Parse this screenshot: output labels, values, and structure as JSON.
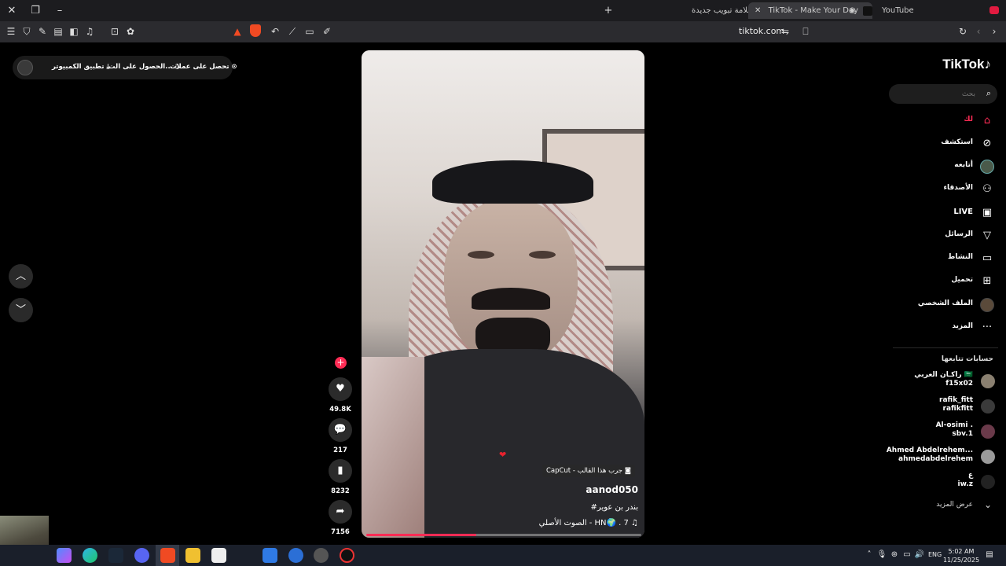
{
  "browser": {
    "tabs": [
      {
        "title": "علامة تبويب جديدة"
      },
      {
        "title": "TikTok - Make Your Day"
      },
      {
        "title": "YouTube"
      }
    ],
    "url": "tiktok.com"
  },
  "promo": {
    "items": [
      {
        "label": "تحصل على عملات",
        "icon": "coin-icon"
      },
      {
        "label": "الحصول على الت...",
        "icon": "phone-icon"
      },
      {
        "label": "تطبيق الكمبيوتر",
        "icon": "download-icon"
      }
    ]
  },
  "video": {
    "effect": "CapCut - جرب هذا القالب",
    "username": "aanod050",
    "hashtag": "#بندر بن عوير",
    "music": "الصوت الأصلي - HN🌍 . 7",
    "progress_percent": 40
  },
  "actions": {
    "likes": "49.8K",
    "comments": "217",
    "saves": "8232",
    "shares": "7156"
  },
  "sidebar": {
    "logo": "TikTok",
    "search_placeholder": "بحث",
    "nav": [
      {
        "label": "لك",
        "icon": "home-icon",
        "active": true
      },
      {
        "label": "استكشف",
        "icon": "compass-icon"
      },
      {
        "label": "أتابعه",
        "icon": "avatar-icon"
      },
      {
        "label": "الأصدقاء",
        "icon": "friends-icon"
      },
      {
        "label": "LIVE",
        "icon": "live-icon"
      },
      {
        "label": "الرسائل",
        "icon": "messages-icon"
      },
      {
        "label": "النشاط",
        "icon": "activity-icon"
      },
      {
        "label": "تحميل",
        "icon": "upload-icon"
      },
      {
        "label": "الملف الشخصي",
        "icon": "profile-icon"
      },
      {
        "label": "المزيد",
        "icon": "more-icon"
      }
    ],
    "following_title": "حسابات تتابعها",
    "following": [
      {
        "name": "راكـان العربي 🇸🇦",
        "handle": "f15x02"
      },
      {
        "name": "rafik_fitt",
        "handle": "rafikfitt"
      },
      {
        "name": "Al-osimi .",
        "handle": "sbv.1"
      },
      {
        "name": "Ahmed Abdelrehem...",
        "handle": "ahmedabdelrehem"
      },
      {
        "name": "ع",
        "handle": "iw.z"
      }
    ],
    "see_more": "عرض المزيد"
  },
  "taskbar": {
    "language": "ENG",
    "time": "5:02 AM",
    "date": "11/25/2025"
  },
  "colors": {
    "accent": "#fe2c55",
    "background": "#000000",
    "sidebar_hover": "#1e1e1e"
  }
}
